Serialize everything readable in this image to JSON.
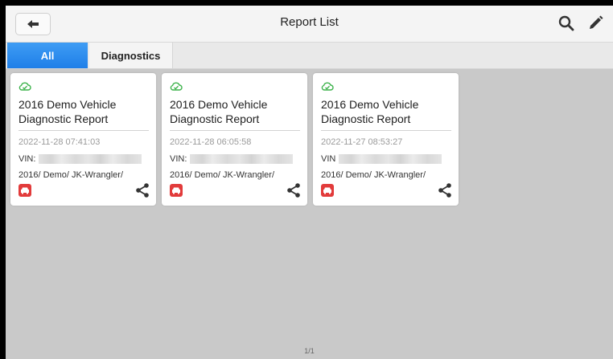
{
  "header": {
    "title": "Report List"
  },
  "tabs": [
    {
      "label": "All"
    },
    {
      "label": "Diagnostics"
    }
  ],
  "reports": [
    {
      "title": "2016 Demo Vehicle Diagnostic Report",
      "date": "2022-11-28 07:41:03",
      "vin_label": "VIN:",
      "path": "2016/ Demo/ JK-Wrangler/"
    },
    {
      "title": "2016 Demo Vehicle Diagnostic Report",
      "date": "2022-11-28 06:05:58",
      "vin_label": "VIN:",
      "path": "2016/ Demo/ JK-Wrangler/"
    },
    {
      "title": "2016 Demo Vehicle Diagnostic Report",
      "date": "2022-11-27 08:53:27",
      "vin_label": "VIN",
      "path": "2016/ Demo/ JK-Wrangler/"
    }
  ],
  "pagination": {
    "text": "1/1"
  },
  "colors": {
    "accent": "#2a8cf0",
    "success": "#3bb24a",
    "car_badge": "#e23b3b"
  },
  "icons": [
    "back-arrow-icon",
    "search-icon",
    "edit-icon",
    "cloud-check-icon",
    "car-icon",
    "share-icon"
  ]
}
